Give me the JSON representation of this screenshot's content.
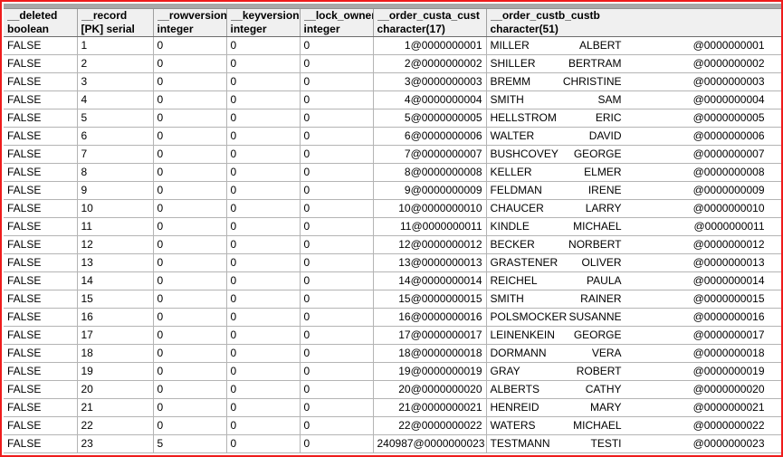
{
  "grid": {
    "columns": [
      {
        "name": "__deleted",
        "type": "boolean",
        "align": "left"
      },
      {
        "name": "__record",
        "type": "[PK] serial",
        "align": "left"
      },
      {
        "name": "__rowversion",
        "type": "integer",
        "align": "left"
      },
      {
        "name": "__keyversion",
        "type": "integer",
        "align": "left"
      },
      {
        "name": "__lock_owner",
        "type": "integer",
        "align": "left"
      },
      {
        "name": "__order_custa_cust",
        "type": "character(17)",
        "align": "right"
      },
      {
        "name": "__order_custb_custb",
        "type": "character(51)",
        "align": "left"
      }
    ],
    "rows": [
      {
        "deleted": "FALSE",
        "record": "1",
        "rowversion": "0",
        "keyversion": "0",
        "lock_owner": "0",
        "custa": "1@0000000001",
        "last": "MILLER",
        "first": "ALBERT",
        "id": "@0000000001"
      },
      {
        "deleted": "FALSE",
        "record": "2",
        "rowversion": "0",
        "keyversion": "0",
        "lock_owner": "0",
        "custa": "2@0000000002",
        "last": "SHILLER",
        "first": "BERTRAM",
        "id": "@0000000002"
      },
      {
        "deleted": "FALSE",
        "record": "3",
        "rowversion": "0",
        "keyversion": "0",
        "lock_owner": "0",
        "custa": "3@0000000003",
        "last": "BREMM",
        "first": "CHRISTINE",
        "id": "@0000000003"
      },
      {
        "deleted": "FALSE",
        "record": "4",
        "rowversion": "0",
        "keyversion": "0",
        "lock_owner": "0",
        "custa": "4@0000000004",
        "last": "SMITH",
        "first": "SAM",
        "id": "@0000000004"
      },
      {
        "deleted": "FALSE",
        "record": "5",
        "rowversion": "0",
        "keyversion": "0",
        "lock_owner": "0",
        "custa": "5@0000000005",
        "last": "HELLSTROM",
        "first": "ERIC",
        "id": "@0000000005"
      },
      {
        "deleted": "FALSE",
        "record": "6",
        "rowversion": "0",
        "keyversion": "0",
        "lock_owner": "0",
        "custa": "6@0000000006",
        "last": "WALTER",
        "first": "DAVID",
        "id": "@0000000006"
      },
      {
        "deleted": "FALSE",
        "record": "7",
        "rowversion": "0",
        "keyversion": "0",
        "lock_owner": "0",
        "custa": "7@0000000007",
        "last": "BUSHCOVEY",
        "first": "GEORGE",
        "id": "@0000000007"
      },
      {
        "deleted": "FALSE",
        "record": "8",
        "rowversion": "0",
        "keyversion": "0",
        "lock_owner": "0",
        "custa": "8@0000000008",
        "last": "KELLER",
        "first": "ELMER",
        "id": "@0000000008"
      },
      {
        "deleted": "FALSE",
        "record": "9",
        "rowversion": "0",
        "keyversion": "0",
        "lock_owner": "0",
        "custa": "9@0000000009",
        "last": "FELDMAN",
        "first": "IRENE",
        "id": "@0000000009"
      },
      {
        "deleted": "FALSE",
        "record": "10",
        "rowversion": "0",
        "keyversion": "0",
        "lock_owner": "0",
        "custa": "10@0000000010",
        "last": "CHAUCER",
        "first": "LARRY",
        "id": "@0000000010"
      },
      {
        "deleted": "FALSE",
        "record": "11",
        "rowversion": "0",
        "keyversion": "0",
        "lock_owner": "0",
        "custa": "11@0000000011",
        "last": "KINDLE",
        "first": "MICHAEL",
        "id": "@0000000011"
      },
      {
        "deleted": "FALSE",
        "record": "12",
        "rowversion": "0",
        "keyversion": "0",
        "lock_owner": "0",
        "custa": "12@0000000012",
        "last": "BECKER",
        "first": "NORBERT",
        "id": "@0000000012"
      },
      {
        "deleted": "FALSE",
        "record": "13",
        "rowversion": "0",
        "keyversion": "0",
        "lock_owner": "0",
        "custa": "13@0000000013",
        "last": "GRASTENER",
        "first": "OLIVER",
        "id": "@0000000013"
      },
      {
        "deleted": "FALSE",
        "record": "14",
        "rowversion": "0",
        "keyversion": "0",
        "lock_owner": "0",
        "custa": "14@0000000014",
        "last": "REICHEL",
        "first": "PAULA",
        "id": "@0000000014"
      },
      {
        "deleted": "FALSE",
        "record": "15",
        "rowversion": "0",
        "keyversion": "0",
        "lock_owner": "0",
        "custa": "15@0000000015",
        "last": "SMITH",
        "first": "RAINER",
        "id": "@0000000015"
      },
      {
        "deleted": "FALSE",
        "record": "16",
        "rowversion": "0",
        "keyversion": "0",
        "lock_owner": "0",
        "custa": "16@0000000016",
        "last": "POLSMOCKER",
        "first": "SUSANNE",
        "id": "@0000000016"
      },
      {
        "deleted": "FALSE",
        "record": "17",
        "rowversion": "0",
        "keyversion": "0",
        "lock_owner": "0",
        "custa": "17@0000000017",
        "last": "LEINENKEIN",
        "first": "GEORGE",
        "id": "@0000000017"
      },
      {
        "deleted": "FALSE",
        "record": "18",
        "rowversion": "0",
        "keyversion": "0",
        "lock_owner": "0",
        "custa": "18@0000000018",
        "last": "DORMANN",
        "first": "VERA",
        "id": "@0000000018"
      },
      {
        "deleted": "FALSE",
        "record": "19",
        "rowversion": "0",
        "keyversion": "0",
        "lock_owner": "0",
        "custa": "19@0000000019",
        "last": "GRAY",
        "first": "ROBERT",
        "id": "@0000000019"
      },
      {
        "deleted": "FALSE",
        "record": "20",
        "rowversion": "0",
        "keyversion": "0",
        "lock_owner": "0",
        "custa": "20@0000000020",
        "last": "ALBERTS",
        "first": "CATHY",
        "id": "@0000000020"
      },
      {
        "deleted": "FALSE",
        "record": "21",
        "rowversion": "0",
        "keyversion": "0",
        "lock_owner": "0",
        "custa": "21@0000000021",
        "last": "HENREID",
        "first": "MARY",
        "id": "@0000000021"
      },
      {
        "deleted": "FALSE",
        "record": "22",
        "rowversion": "0",
        "keyversion": "0",
        "lock_owner": "0",
        "custa": "22@0000000022",
        "last": "WATERS",
        "first": "MICHAEL",
        "id": "@0000000022"
      },
      {
        "deleted": "FALSE",
        "record": "23",
        "rowversion": "5",
        "keyversion": "0",
        "lock_owner": "0",
        "custa": "240987@0000000023",
        "last": "TESTMANN",
        "first": "TESTI",
        "id": "@0000000023"
      }
    ]
  },
  "colors": {
    "frame": "#ee1c1c",
    "header_bg": "#f0f0f0",
    "grid_line": "#b4b4b4",
    "strip": "#a8a8a8"
  }
}
